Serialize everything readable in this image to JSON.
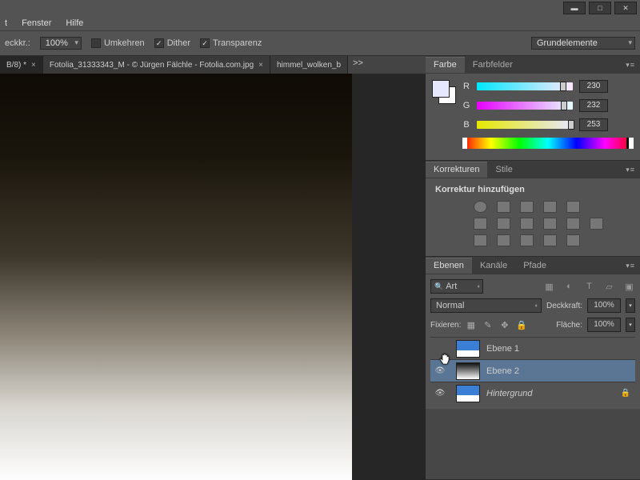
{
  "menu": {
    "t": "t",
    "fenster": "Fenster",
    "hilfe": "Hilfe"
  },
  "options": {
    "eckkr_label": "eckkr.:",
    "eckkr_value": "100%",
    "umkehren": "Umkehren",
    "dither": "Dither",
    "transparenz": "Transparenz",
    "workspace": "Grundelemente"
  },
  "tabs": {
    "t1": "B/8) *",
    "t2": "Fotolia_31333343_M - © Jürgen Fälchle - Fotolia.com.jpg",
    "t3": "himmel_wolken_b",
    "more": ">>"
  },
  "color": {
    "tab1": "Farbe",
    "tab2": "Farbfelder",
    "r": "R",
    "g": "G",
    "b": "B",
    "r_val": "230",
    "g_val": "232",
    "b_val": "253"
  },
  "adjust": {
    "tab1": "Korrekturen",
    "tab2": "Stile",
    "title": "Korrektur hinzufügen"
  },
  "layers": {
    "tab1": "Ebenen",
    "tab2": "Kanäle",
    "tab3": "Pfade",
    "search": "Art",
    "blend": "Normal",
    "opacity_label": "Deckkraft:",
    "opacity_value": "100%",
    "lock_label": "Fixieren:",
    "fill_label": "Fläche:",
    "fill_value": "100%",
    "items": [
      {
        "name": "Ebene 1"
      },
      {
        "name": "Ebene 2"
      },
      {
        "name": "Hintergrund"
      }
    ]
  }
}
